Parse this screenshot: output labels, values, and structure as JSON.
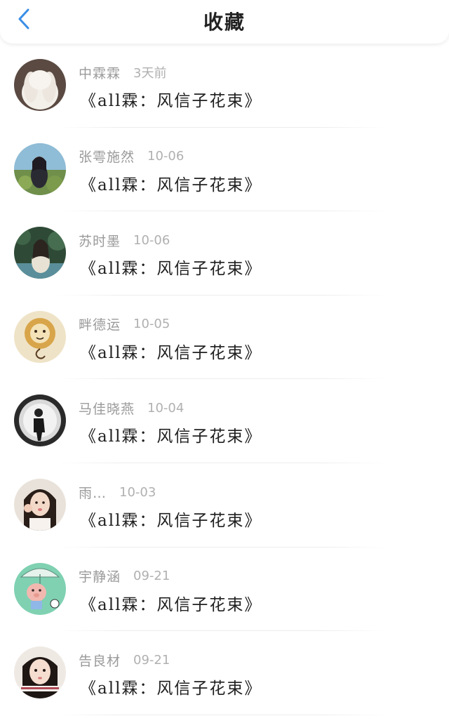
{
  "header": {
    "title": "收藏",
    "back_icon": "chevron-left-icon",
    "accent": "#3a8ee6"
  },
  "items": [
    {
      "name": "中霖霖",
      "time": "3天前",
      "title": "《all霖：风信子花束》",
      "avatar": "bunny-avatar"
    },
    {
      "name": "张雩施然",
      "time": "10-06",
      "title": "《all霖：风信子花束》",
      "avatar": "girl-outdoor-avatar"
    },
    {
      "name": "苏时墨",
      "time": "10-06",
      "title": "《all霖：风信子花束》",
      "avatar": "girl-garden-avatar"
    },
    {
      "name": "畔德运",
      "time": "10-05",
      "title": "《all霖：风信子花束》",
      "avatar": "cartoon-lion-avatar"
    },
    {
      "name": "马佳晓燕",
      "time": "10-04",
      "title": "《all霖：风信子花束》",
      "avatar": "bw-figure-avatar"
    },
    {
      "name": "雨…",
      "time": "10-03",
      "title": "《all霖：风信子花束》",
      "avatar": "girl-selfie-avatar"
    },
    {
      "name": "宇静涵",
      "time": "09-21",
      "title": "《all霖：风信子花束》",
      "avatar": "cartoon-pig-avatar"
    },
    {
      "name": "告良材",
      "time": "09-21",
      "title": "《all霖：风信子花束》",
      "avatar": "girl-portrait-avatar"
    }
  ]
}
